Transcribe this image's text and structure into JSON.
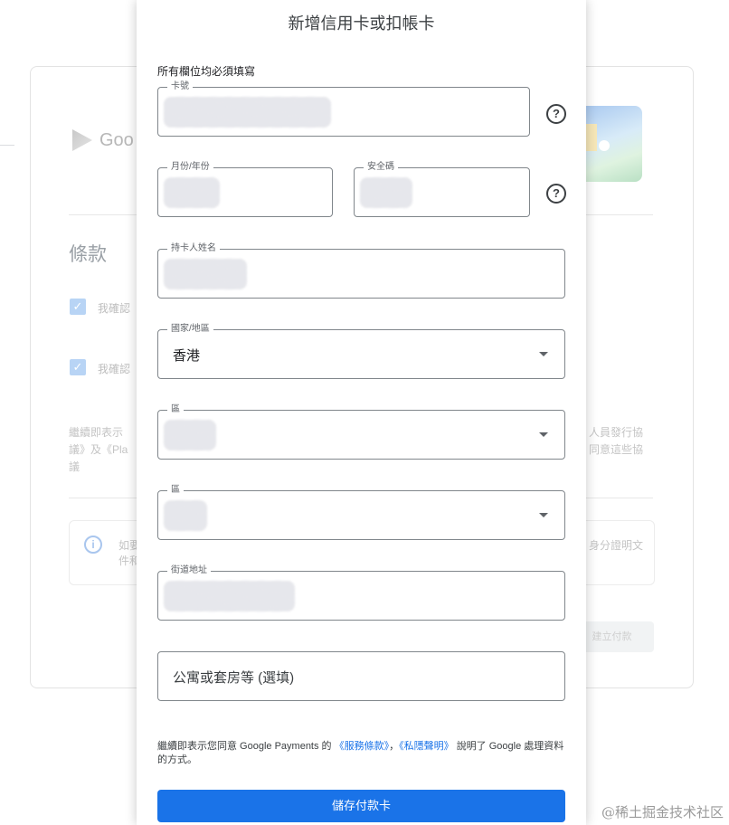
{
  "background": {
    "brand": "Goo",
    "terms_title": "條款",
    "check1_label": "我確認",
    "check2_label": "我確認",
    "notice_left_1": "繼續即表示",
    "notice_left_2": "議》及《Pla",
    "notice_left_3": "議",
    "notice_right_1": "人員發行協",
    "notice_right_2": "同意這些協",
    "info_left_1": "如要",
    "info_left_2": "件和",
    "info_right": "身分證明文",
    "button_label": "建立付款"
  },
  "dialog": {
    "title": "新增信用卡或扣帳卡",
    "required_note": "所有欄位均必須填寫",
    "fields": {
      "card_number": {
        "label": "卡號"
      },
      "expiry": {
        "label": "月份/年份"
      },
      "cvc": {
        "label": "安全碼"
      },
      "cardholder": {
        "label": "持卡人姓名"
      },
      "country": {
        "label": "國家/地區",
        "value": "香港"
      },
      "district1": {
        "label": "區"
      },
      "district2": {
        "label": "區"
      },
      "street": {
        "label": "街道地址"
      },
      "apartment": {
        "placeholder": "公寓或套房等 (選填)"
      }
    },
    "help_glyph": "?",
    "legal": {
      "prefix": "繼續即表示您同意 Google Payments 的",
      "terms_link": "《服務條款》",
      "separator": "，",
      "privacy_link": "《私隱聲明》",
      "suffix": "說明了 Google 處理資料的方式。"
    },
    "save_label": "儲存付款卡"
  },
  "watermark": "@稀土掘金技术社区",
  "colors": {
    "accent": "#1a73e8",
    "border": "#80868b"
  }
}
